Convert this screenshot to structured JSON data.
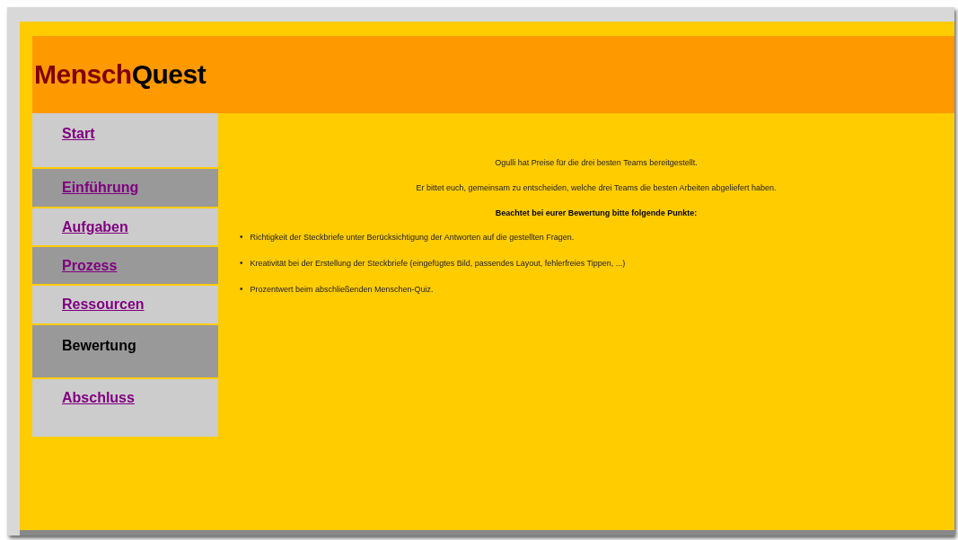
{
  "header": {
    "logo_first": "Mensch",
    "logo_second": "Quest"
  },
  "nav": [
    {
      "label": "Start",
      "selected": false
    },
    {
      "label": "Einführung",
      "selected": false
    },
    {
      "label": "Aufgaben",
      "selected": false
    },
    {
      "label": "Prozess",
      "selected": false
    },
    {
      "label": "Ressourcen",
      "selected": false
    },
    {
      "label": "Bewertung",
      "selected": true
    },
    {
      "label": "Abschluss",
      "selected": false
    }
  ],
  "content": {
    "paragraphs": [
      "Ogulli hat Preise für die drei besten Teams bereitgestellt.",
      "Er bittet euch, gemeinsam zu entscheiden, welche drei Teams die besten Arbeiten abgeliefert haben."
    ],
    "heading": "Beachtet bei eurer Bewertung bitte folgende Punkte:",
    "bullets": [
      {
        "marker": "•",
        "text": "Richtigkeit der Steckbriefe unter Berücksichtigung der Antworten auf die gestellten Fragen."
      },
      {
        "marker": "•",
        "text": "Kreativität bei der Erstellung der Steckbriefe (eingefügtes Bild, passendes Layout, fehlerfreies Tippen, ...)"
      },
      {
        "marker": "•",
        "text": "Prozentwert beim abschließenden Menschen-Quiz."
      }
    ]
  }
}
